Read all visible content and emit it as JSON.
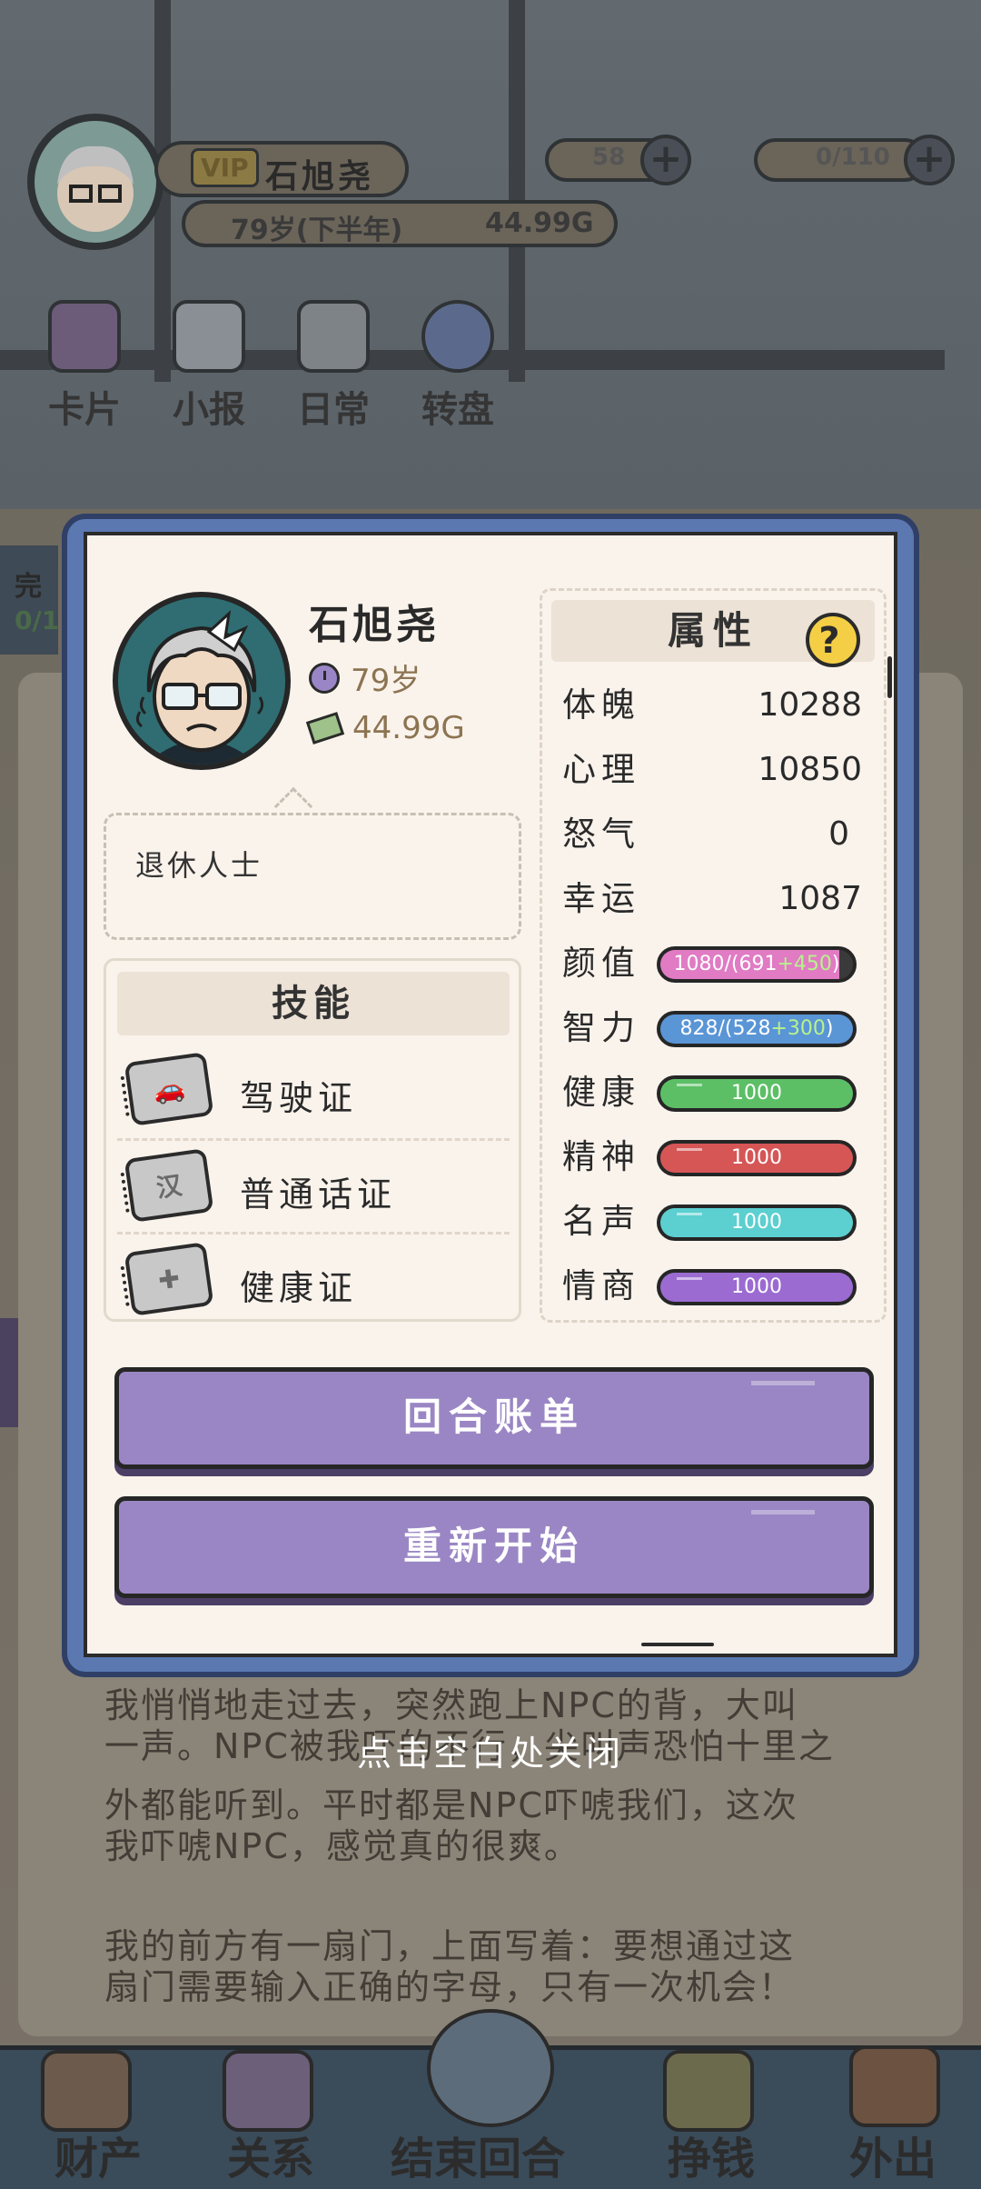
{
  "topbar": {
    "vip": "VIP",
    "name": "石旭尧",
    "age": "79岁(下半年)",
    "money": "44.99G",
    "gems": "58",
    "energy": "0/110"
  },
  "menu": [
    {
      "label": "卡片",
      "icon": "cards-icon"
    },
    {
      "label": "小报",
      "icon": "newspaper-icon"
    },
    {
      "label": "日常",
      "icon": "checklist-icon"
    },
    {
      "label": "转盘",
      "icon": "wheel-icon"
    }
  ],
  "side_tab": {
    "label1": "完",
    "label2": "0/1"
  },
  "story": {
    "lines1": [
      "我悄悄地走过去，突然跑上NPC的背，大叫",
      "一声。NPC被我吓的不行，尖叫声恐怕十里之",
      "外都能听到。平时都是NPC吓唬我们，这次",
      "我吓唬NPC，感觉真的很爽。"
    ],
    "lines2": [
      "我的前方有一扇门，上面写着：要想通过这",
      "扇门需要输入正确的字母，只有一次机会！"
    ]
  },
  "bottom_nav": [
    {
      "label": "财产",
      "icon": "house-icon"
    },
    {
      "label": "关系",
      "icon": "contacts-book-icon"
    },
    {
      "label": "结束回合",
      "icon": "alarm-clock-icon"
    },
    {
      "label": "挣钱",
      "icon": "fist-money-icon"
    },
    {
      "label": "外出",
      "icon": "door-exit-icon"
    }
  ],
  "profile": {
    "name": "石旭尧",
    "age": "79岁",
    "money": "44.99G",
    "title": "退休人士"
  },
  "skills": {
    "header": "技能",
    "items": [
      {
        "label": "驾驶证",
        "icon": "car-card-icon",
        "glyph": "🚗"
      },
      {
        "label": "普通话证",
        "icon": "mandarin-card-icon",
        "glyph": "汉"
      },
      {
        "label": "健康证",
        "icon": "health-card-icon",
        "glyph": "✚"
      }
    ]
  },
  "attributes": {
    "header": "属性",
    "help": "?",
    "stats": [
      {
        "name": "体魄",
        "value": "10288"
      },
      {
        "name": "心理",
        "value": "10850"
      },
      {
        "name": "怒气",
        "value": "0"
      },
      {
        "name": "幸运",
        "value": "1087"
      }
    ],
    "bars": [
      {
        "name": "颜值",
        "text": "1080/(691",
        "plus": "+450",
        "close": ")",
        "color": "#e07bc4",
        "fill": 0.93
      },
      {
        "name": "智力",
        "text": "828/(528",
        "plus": "+300",
        "close": ")",
        "color": "#5a95d6",
        "fill": 1.0
      },
      {
        "name": "健康",
        "text": "1000",
        "plus": "",
        "close": "",
        "color": "#5cbf66",
        "fill": 1.0
      },
      {
        "name": "精神",
        "text": "1000",
        "plus": "",
        "close": "",
        "color": "#d65656",
        "fill": 1.0
      },
      {
        "name": "名声",
        "text": "1000",
        "plus": "",
        "close": "",
        "color": "#5ccfd0",
        "fill": 1.0
      },
      {
        "name": "情商",
        "text": "1000",
        "plus": "",
        "close": "",
        "color": "#9b6bd1",
        "fill": 1.0
      }
    ]
  },
  "buttons": {
    "bill": "回合账单",
    "restart": "重新开始"
  },
  "close_hint": "点击空白处关闭",
  "colors": {
    "modal_frame": "#5b78b1",
    "button": "#9a86c4",
    "help": "#f4cf45"
  }
}
